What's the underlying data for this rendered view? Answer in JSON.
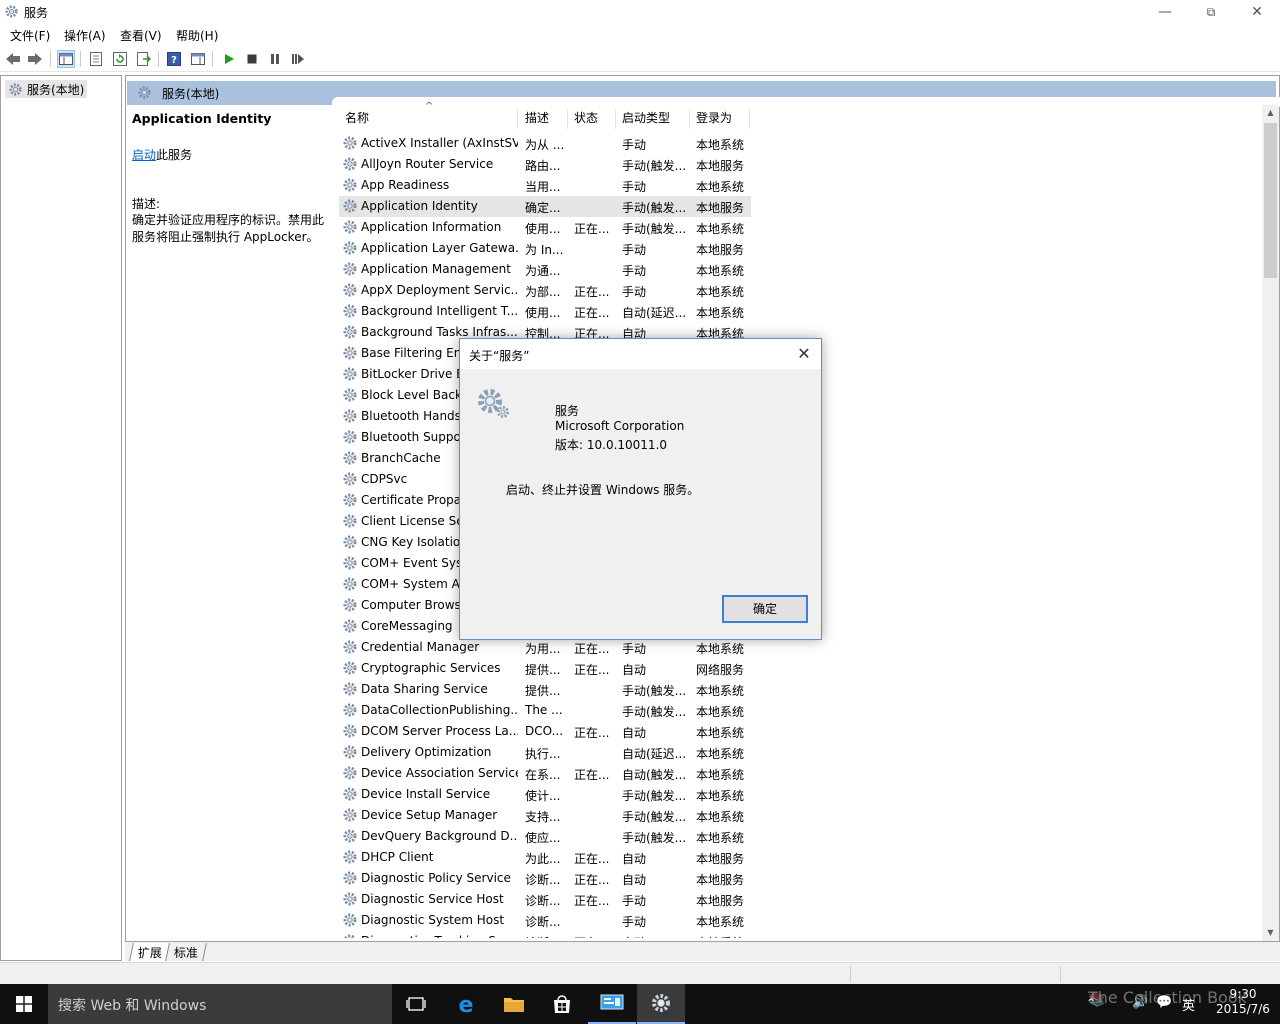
{
  "window": {
    "title": "服务",
    "icon": "services-gear-icon"
  },
  "menu": [
    "文件(F)",
    "操作(A)",
    "查看(V)",
    "帮助(H)"
  ],
  "toolbar": {
    "icons": [
      "back-arrow-icon",
      "forward-arrow-icon",
      "show-hide-tree-icon",
      "properties-icon",
      "refresh-icon",
      "export-list-icon",
      "help-icon",
      "show-hide-action-pane-icon",
      "start-service-icon",
      "stop-service-icon",
      "pause-service-icon",
      "resume-service-icon"
    ]
  },
  "tree": {
    "root_label": "服务(本地)"
  },
  "main": {
    "header_label": "服务(本地)",
    "detail": {
      "service_name": "Application Identity",
      "start_link": "启动",
      "start_suffix": "此服务",
      "desc_label": "描述:",
      "desc_text": "确定并验证应用程序的标识。禁用此服务将阻止强制执行 AppLocker。"
    },
    "columns": [
      "名称",
      "描述",
      "状态",
      "启动类型",
      "登录为"
    ],
    "sort_indicator": "^",
    "rows": [
      [
        "ActiveX Installer (AxInstSV)",
        "为从 ...",
        "",
        "手动",
        "本地系统"
      ],
      [
        "AllJoyn Router Service",
        "路由...",
        "",
        "手动(触发...",
        "本地服务"
      ],
      [
        "App Readiness",
        "当用...",
        "",
        "手动",
        "本地系统"
      ],
      [
        "Application Identity",
        "确定...",
        "",
        "手动(触发...",
        "本地服务"
      ],
      [
        "Application Information",
        "使用...",
        "正在...",
        "手动(触发...",
        "本地系统"
      ],
      [
        "Application Layer Gatewa...",
        "为 In...",
        "",
        "手动",
        "本地服务"
      ],
      [
        "Application Management",
        "为通...",
        "",
        "手动",
        "本地系统"
      ],
      [
        "AppX Deployment Servic...",
        "为部...",
        "正在...",
        "手动",
        "本地系统"
      ],
      [
        "Background Intelligent T...",
        "使用...",
        "正在...",
        "自动(延迟...",
        "本地系统"
      ],
      [
        "Background Tasks Infras...",
        "控制...",
        "正在...",
        "自动",
        "本地系统"
      ],
      [
        "Base Filtering Eng",
        "",
        "",
        "",
        ""
      ],
      [
        "BitLocker Drive E",
        "",
        "",
        "",
        ""
      ],
      [
        "Block Level Back",
        "",
        "",
        "",
        ""
      ],
      [
        "Bluetooth Hands",
        "",
        "",
        "",
        ""
      ],
      [
        "Bluetooth Suppo",
        "",
        "",
        "",
        ""
      ],
      [
        "BranchCache",
        "",
        "",
        "",
        ""
      ],
      [
        "CDPSvc",
        "",
        "",
        "",
        ""
      ],
      [
        "Certificate Propa",
        "",
        "",
        "",
        ""
      ],
      [
        "Client License Se",
        "",
        "",
        "",
        ""
      ],
      [
        "CNG Key Isolatio",
        "",
        "",
        "",
        ""
      ],
      [
        "COM+ Event Syst",
        "",
        "",
        "",
        ""
      ],
      [
        "COM+ System Ap",
        "",
        "",
        "",
        ""
      ],
      [
        "Computer Brows",
        "",
        "",
        "",
        ""
      ],
      [
        "CoreMessaging",
        "",
        "",
        "",
        ""
      ],
      [
        "Credential Manager",
        "为用...",
        "正在...",
        "手动",
        "本地系统"
      ],
      [
        "Cryptographic Services",
        "提供...",
        "正在...",
        "自动",
        "网络服务"
      ],
      [
        "Data Sharing Service",
        "提供...",
        "",
        "手动(触发...",
        "本地系统"
      ],
      [
        "DataCollectionPublishing...",
        "The ...",
        "",
        "手动(触发...",
        "本地系统"
      ],
      [
        "DCOM Server Process La...",
        "DCO...",
        "正在...",
        "自动",
        "本地系统"
      ],
      [
        "Delivery Optimization",
        "执行...",
        "",
        "自动(延迟...",
        "本地系统"
      ],
      [
        "Device Association Service",
        "在系...",
        "正在...",
        "自动(触发...",
        "本地系统"
      ],
      [
        "Device Install Service",
        "使计...",
        "",
        "手动(触发...",
        "本地系统"
      ],
      [
        "Device Setup Manager",
        "支持...",
        "",
        "手动(触发...",
        "本地系统"
      ],
      [
        "DevQuery Background D...",
        "使应...",
        "",
        "手动(触发...",
        "本地系统"
      ],
      [
        "DHCP Client",
        "为此...",
        "正在...",
        "自动",
        "本地服务"
      ],
      [
        "Diagnostic Policy Service",
        "诊断...",
        "正在...",
        "自动",
        "本地服务"
      ],
      [
        "Diagnostic Service Host",
        "诊断...",
        "正在...",
        "手动",
        "本地服务"
      ],
      [
        "Diagnostic System Host",
        "诊断...",
        "",
        "手动",
        "本地系统"
      ],
      [
        "Diagnostics Tracking Ser...",
        "诊断...",
        "正在...",
        "自动",
        "本地系统"
      ]
    ],
    "selected_row": 3
  },
  "tabs": [
    "扩展",
    "标准"
  ],
  "dialog": {
    "title": "关于“服务”",
    "app_name": "服务",
    "company": "Microsoft Corporation",
    "version": "版本: 10.0.10011.0",
    "description": "启动、终止并设置 Windows 服务。",
    "ok_label": "确定"
  },
  "taskbar": {
    "search_placeholder": "搜索 Web 和 Windows",
    "apps": [
      "task-view-icon",
      "edge-icon",
      "file-explorer-icon",
      "store-icon",
      "computer-management-icon",
      "services-icon"
    ],
    "time": "9:30",
    "date": "2015/7/6",
    "ime": "英",
    "watermark": "The Collection Book"
  }
}
